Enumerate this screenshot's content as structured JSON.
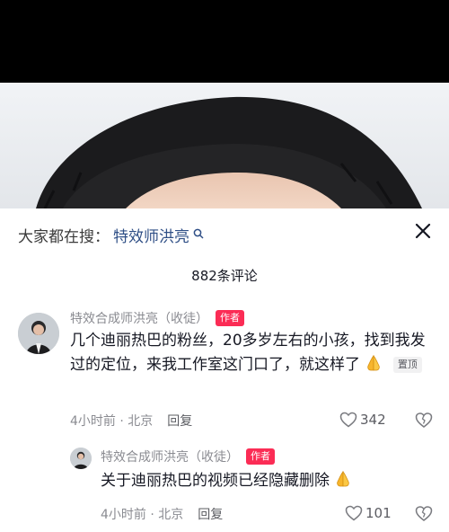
{
  "search": {
    "prefix": "大家都在搜：",
    "term": "特效师洪亮"
  },
  "comments_header": {
    "count_label": "882条评论"
  },
  "comments": [
    {
      "username": "特效合成师洪亮（收徒）",
      "badge": "作者",
      "text": "几个迪丽热巴的粉丝，20多岁左右的小孩，找到我发过的定位，来我工作室这门口了，就这样了",
      "pin_label": "置顶",
      "time_location": "4小时前 · 北京",
      "reply_label": "回复",
      "likes": "342"
    },
    {
      "username": "特效合成师洪亮（收徒）",
      "badge": "作者",
      "text": "关于迪丽热巴的视频已经隐藏删除",
      "time_location": "4小时前 · 北京",
      "reply_label": "回复",
      "likes": "101"
    }
  ],
  "icons": {
    "close": "close-icon",
    "search": "search-icon",
    "like": "heart-icon",
    "dislike": "broken-heart-icon",
    "emoji": "folded-hands-emoji"
  },
  "colors": {
    "search_term": "#2f4f86",
    "author_badge": "#fb2c55",
    "secondary_text": "#8a8b91"
  }
}
